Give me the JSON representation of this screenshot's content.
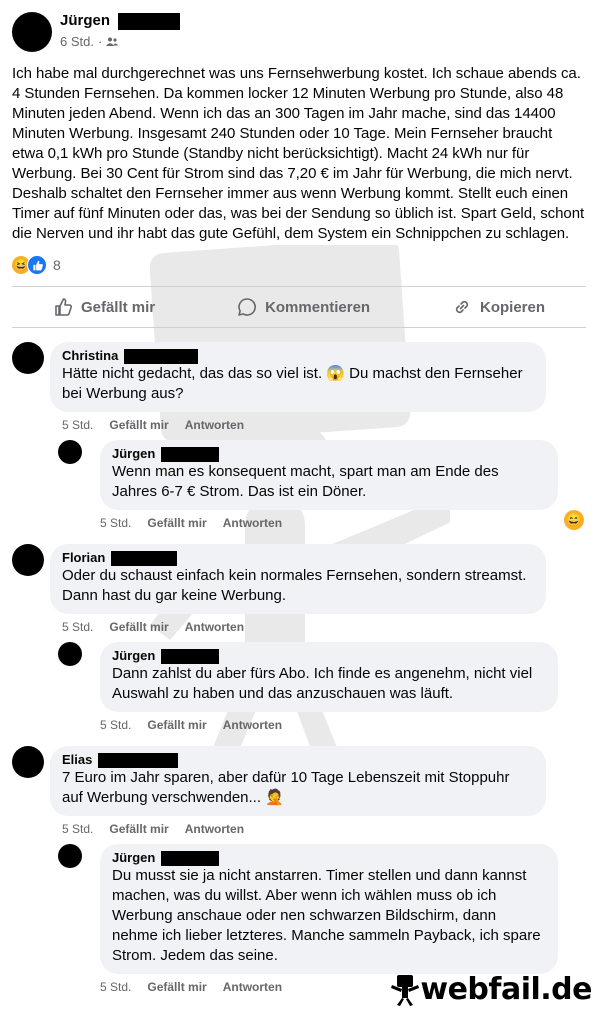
{
  "post": {
    "author": "Jürgen",
    "time": "6 Std.",
    "separator": "·",
    "audience_icon": "friends-icon",
    "body": "Ich habe mal durchgerechnet was uns Fernsehwerbung kostet. Ich schaue abends ca. 4 Stunden Fernsehen. Da kommen locker 12 Minuten Werbung pro Stunde, also 48 Minuten jeden Abend. Wenn ich das an 300 Tagen im Jahr mache, sind das 14400 Minuten Werbung. Insgesamt 240 Stunden oder 10 Tage. Mein Fernseher braucht etwa 0,1 kWh pro Stunde (Standby nicht berücksichtigt). Macht 24 kWh nur für Werbung. Bei 30 Cent für Strom sind das 7,20 € im Jahr für Werbung, die mich nervt.\nDeshalb schaltet den Fernseher immer aus wenn Werbung kommt. Stellt euch einen Timer auf fünf Minuten oder das, was bei der Sendung so üblich ist. Spart Geld, schont die Nerven und ihr habt das gute Gefühl, dem System ein Schnippchen zu schlagen.",
    "reaction_icons": [
      "haha-icon",
      "like-icon"
    ],
    "reaction_count": "8"
  },
  "actions": {
    "like": "Gefällt mir",
    "comment": "Kommentieren",
    "copy": "Kopieren"
  },
  "comments": [
    {
      "author": "Christina",
      "text": "Hätte nicht gedacht, das das so viel ist. 😱 Du machst den Fernseher bei Werbung aus?",
      "time": "5 Std.",
      "like": "Gefällt mir",
      "reply": "Antworten",
      "replies": [
        {
          "author": "Jürgen",
          "text": "Wenn man es konsequent macht, spart man am Ende des Jahres 6-7 € Strom. Das ist ein Döner.",
          "time": "5 Std.",
          "like": "Gefällt mir",
          "reply": "Antworten",
          "reaction": "😄"
        }
      ]
    },
    {
      "author": "Florian",
      "text": "Oder du schaust einfach kein normales Fernsehen, sondern streamst. Dann hast du gar keine Werbung.",
      "time": "5 Std.",
      "like": "Gefällt mir",
      "reply": "Antworten",
      "replies": [
        {
          "author": "Jürgen",
          "text": "Dann zahlst du aber fürs Abo. Ich finde es angenehm, nicht viel Auswahl zu haben und das anzuschauen was läuft.",
          "time": "5 Std.",
          "like": "Gefällt mir",
          "reply": "Antworten"
        }
      ]
    },
    {
      "author": "Elias",
      "text": "7 Euro im Jahr sparen, aber dafür 10 Tage Lebenszeit mit Stoppuhr auf Werbung verschwenden... 🤦",
      "time": "5 Std.",
      "like": "Gefällt mir",
      "reply": "Antworten",
      "replies": [
        {
          "author": "Jürgen",
          "text": "Du musst sie ja nicht anstarren. Timer stellen und dann kannst machen, was du willst. Aber wenn ich wählen muss ob ich Werbung anschaue oder nen schwarzen Bildschirm, dann nehme ich lieber letzteres. Manche sammeln Payback, ich spare Strom. Jedem das seine.",
          "time": "5 Std.",
          "like": "Gefällt mir",
          "reply": "Antworten"
        }
      ]
    }
  ],
  "watermark": {
    "logo_text": "webfail.de"
  }
}
